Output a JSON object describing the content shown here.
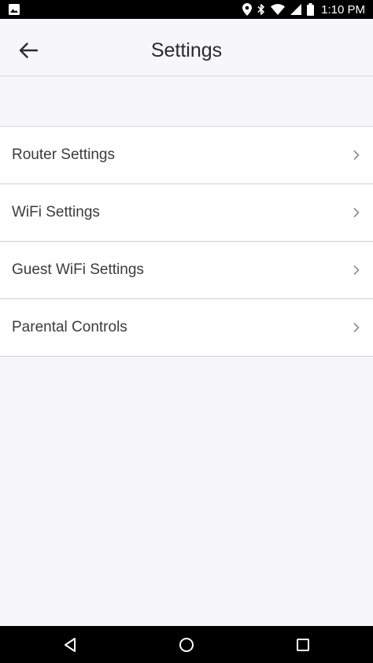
{
  "status_bar": {
    "time": "1:10 PM",
    "icons": [
      "image-icon",
      "location-icon",
      "bluetooth-icon",
      "wifi-icon",
      "signal-icon",
      "battery-icon"
    ]
  },
  "header": {
    "title": "Settings",
    "back_icon": "arrow-left-icon"
  },
  "settings": {
    "items": [
      {
        "label": "Router Settings"
      },
      {
        "label": "WiFi Settings"
      },
      {
        "label": "Guest WiFi Settings"
      },
      {
        "label": "Parental Controls"
      }
    ]
  },
  "nav_bar": {
    "icons": [
      "back-triangle-icon",
      "home-circle-icon",
      "recents-square-icon"
    ]
  },
  "colors": {
    "background": "#f7f7f9",
    "list_background": "#ffffff",
    "text": "#3b3b40",
    "divider": "#d0d0d4",
    "system_bars": "#000000"
  }
}
